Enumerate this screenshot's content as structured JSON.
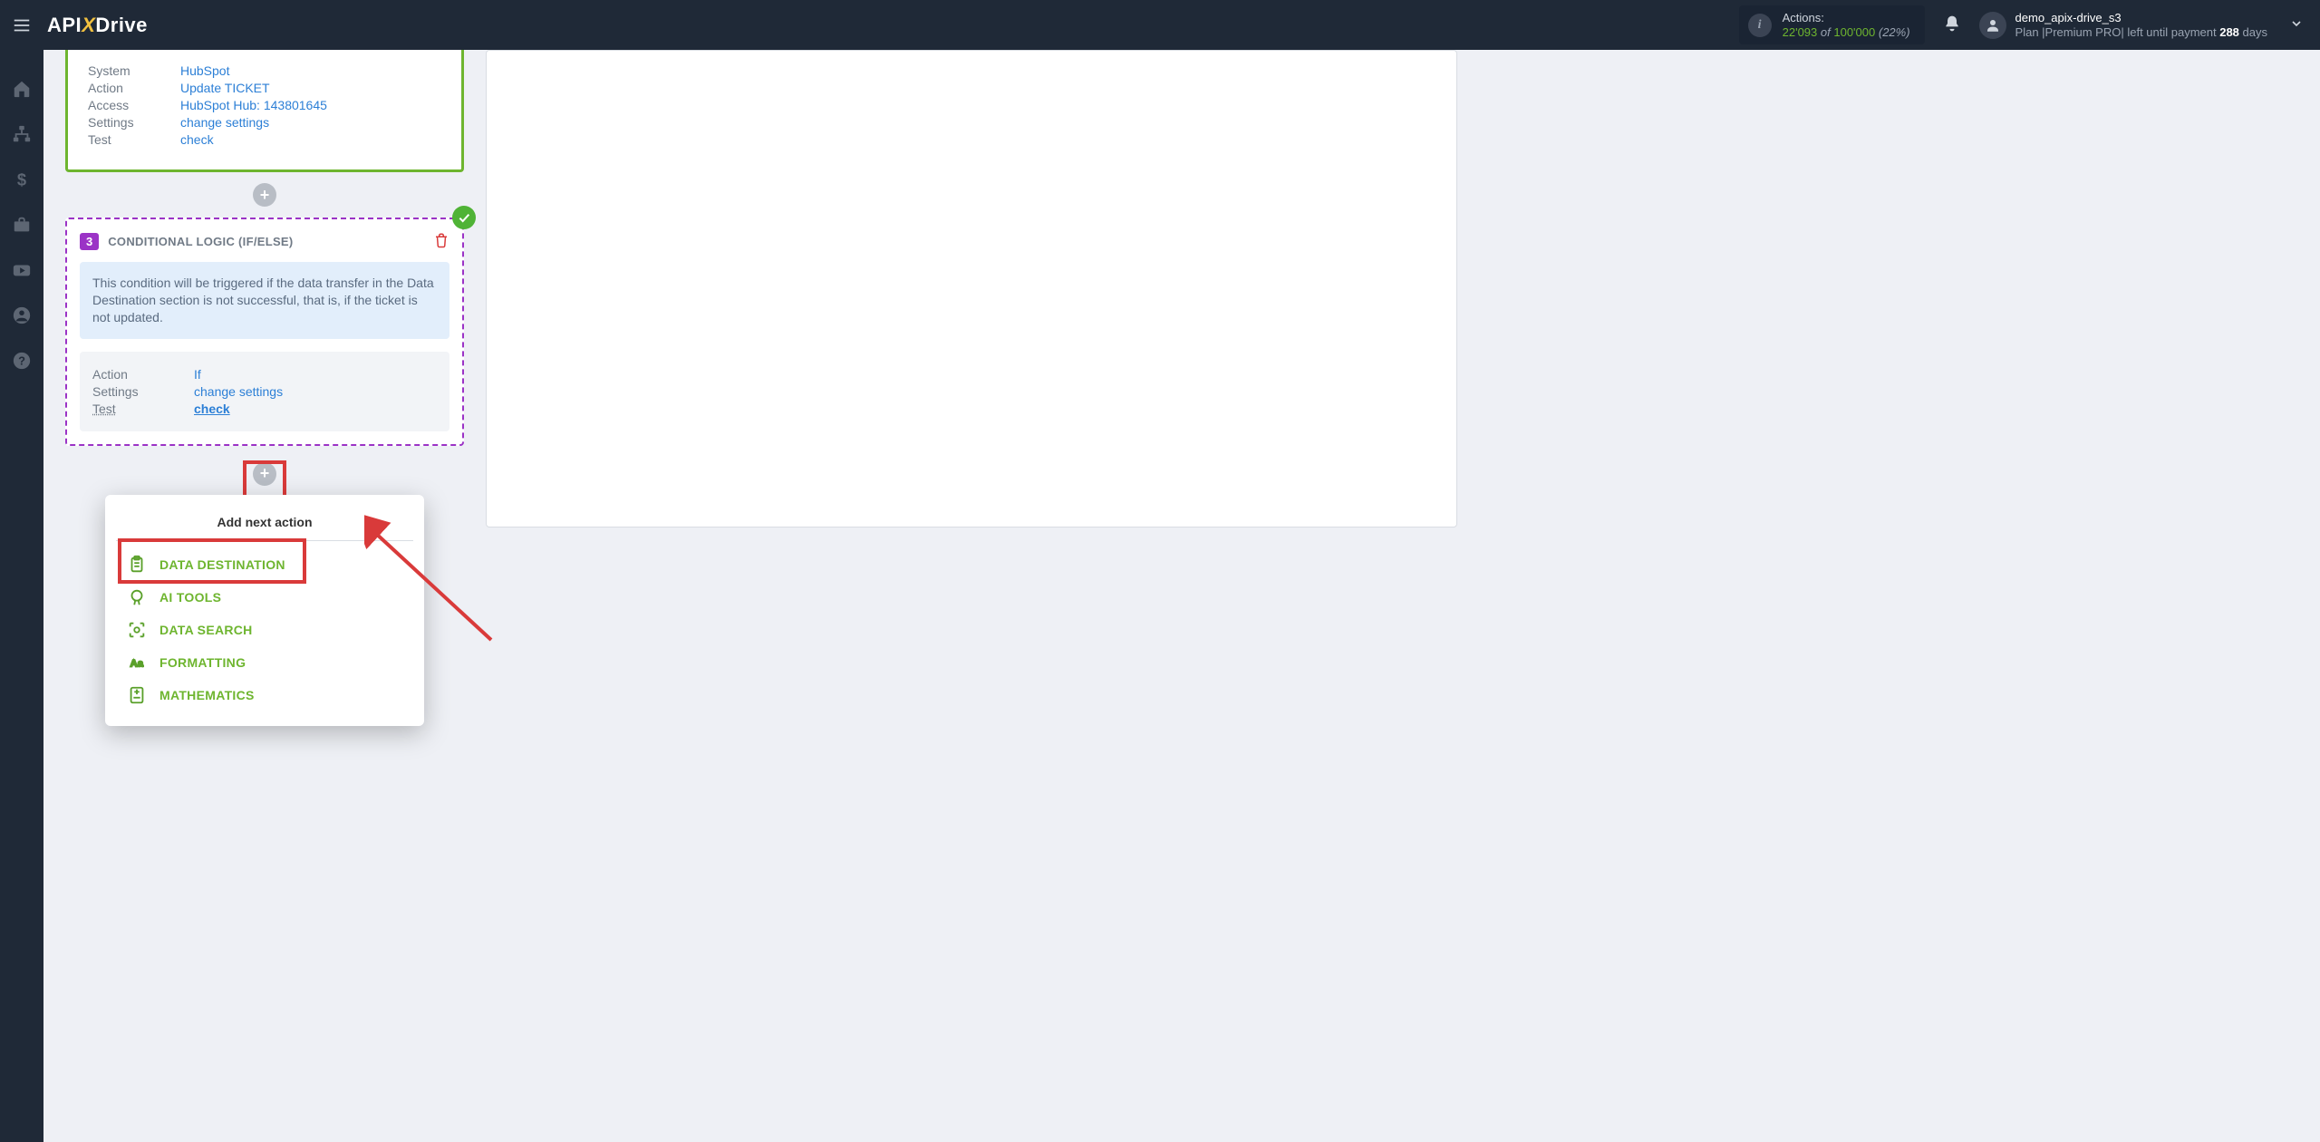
{
  "header": {
    "logo": {
      "a": "API",
      "x": "X",
      "d": "Drive"
    },
    "actions": {
      "label": "Actions:",
      "current": "22'093",
      "of": "of",
      "max": "100'000",
      "pct": "(22%)"
    },
    "user": {
      "name": "demo_apix-drive_s3",
      "plan_prefix": "Plan |Premium PRO| left until payment ",
      "plan_days": "288",
      "plan_suffix": " days"
    }
  },
  "top_card": {
    "rows": {
      "system": {
        "k": "System",
        "v": "HubSpot"
      },
      "action": {
        "k": "Action",
        "v": "Update TICKET"
      },
      "access": {
        "k": "Access",
        "v": "HubSpot Hub: 143801645"
      },
      "settings": {
        "k": "Settings",
        "v": "change settings"
      },
      "test": {
        "k": "Test",
        "v": "check"
      }
    }
  },
  "cond": {
    "num": "3",
    "title": "CONDITIONAL LOGIC (IF/ELSE)",
    "info": "This condition will be triggered if the data transfer in the Data Destination section is not successful, that is, if the ticket is not updated.",
    "rows": {
      "action": {
        "k": "Action",
        "v": "If"
      },
      "settings": {
        "k": "Settings",
        "v": "change settings"
      },
      "test": {
        "k": "Test",
        "v": "check"
      }
    }
  },
  "menu": {
    "title": "Add next action",
    "items": {
      "dd": "DATA DESTINATION",
      "ai": "AI TOOLS",
      "ds": "DATA SEARCH",
      "fmt": "FORMATTING",
      "math": "MATHEMATICS"
    }
  }
}
